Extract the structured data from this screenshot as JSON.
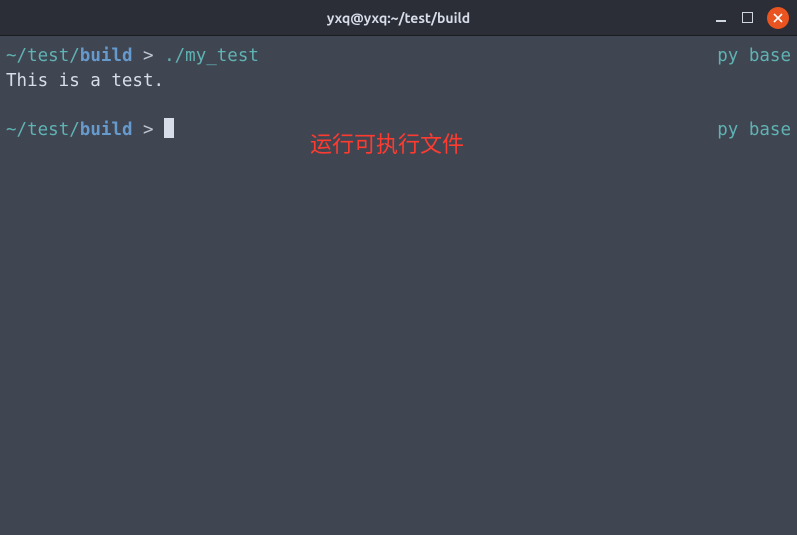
{
  "titlebar": {
    "title": "yxq@yxq:~/test/build"
  },
  "terminal": {
    "lines": [
      {
        "type": "prompt",
        "tilde": "~",
        "path_slash1": "/",
        "path_seg1": "test",
        "path_slash2": "/",
        "path_seg2": "build",
        "prompt_symbol": " > ",
        "command": "./my_test",
        "env": "py base"
      },
      {
        "type": "output",
        "text": "This is a test."
      },
      {
        "type": "blank"
      },
      {
        "type": "prompt_cursor",
        "tilde": "~",
        "path_slash1": "/",
        "path_seg1": "test",
        "path_slash2": "/",
        "path_seg2": "build",
        "prompt_symbol": " > ",
        "env": "py base"
      }
    ]
  },
  "annotation": {
    "text": "运行可执行文件"
  }
}
